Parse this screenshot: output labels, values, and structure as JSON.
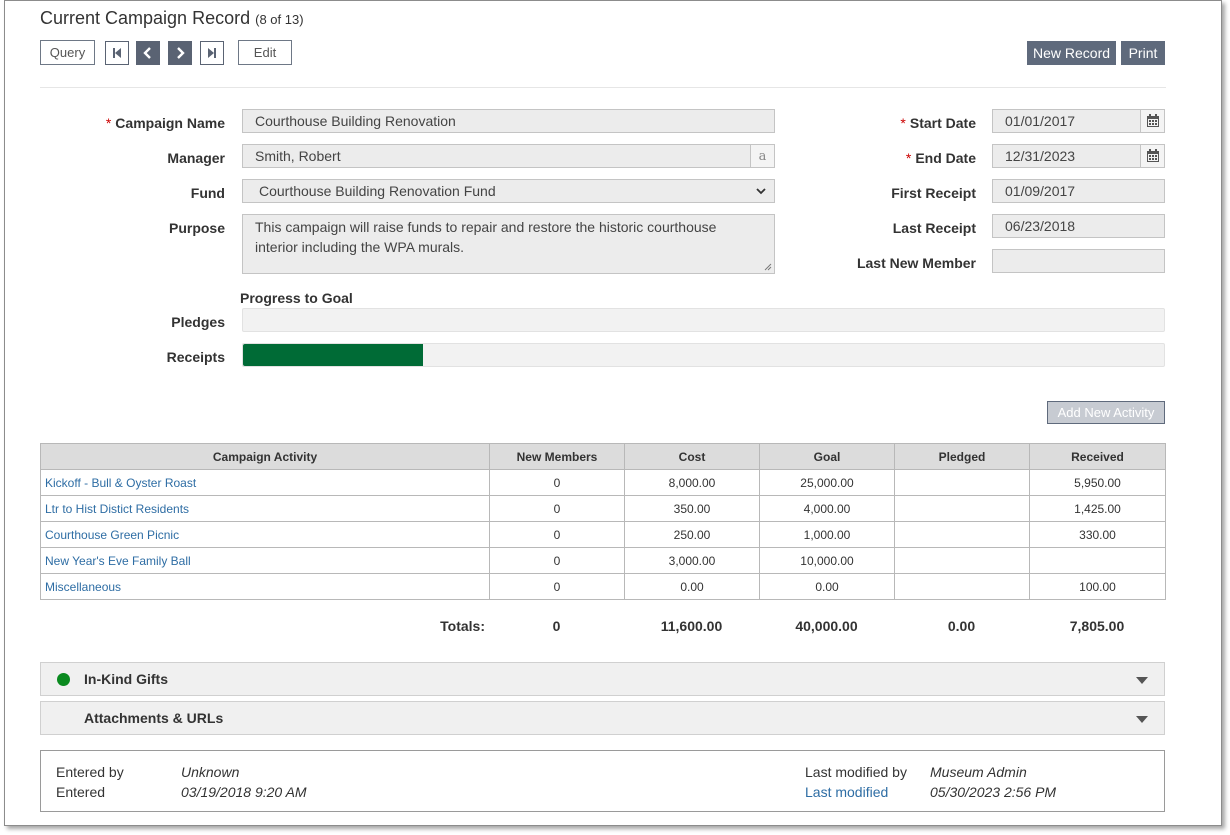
{
  "header": {
    "title": "Current Campaign Record",
    "record_position": "(8 of 13)"
  },
  "toolbar": {
    "query_label": "Query",
    "edit_label": "Edit",
    "new_record_label": "New Record",
    "print_label": "Print"
  },
  "form": {
    "campaign_name": {
      "label": "Campaign Name",
      "required": "*",
      "value": "Courthouse Building Renovation"
    },
    "manager": {
      "label": "Manager",
      "value": "Smith, Robert",
      "lookup_glyph": "a"
    },
    "fund": {
      "label": "Fund",
      "value": "Courthouse Building Renovation Fund"
    },
    "purpose": {
      "label": "Purpose",
      "value": "This campaign will raise funds to repair and restore the historic courthouse interior including the WPA murals."
    },
    "start_date": {
      "label": "Start Date",
      "required": "*",
      "value": "01/01/2017"
    },
    "end_date": {
      "label": "End Date",
      "required": "*",
      "value": "12/31/2023"
    },
    "first_receipt": {
      "label": "First Receipt",
      "value": "01/09/2017"
    },
    "last_receipt": {
      "label": "Last Receipt",
      "value": "06/23/2018"
    },
    "last_new_member": {
      "label": "Last New Member",
      "value": ""
    }
  },
  "progress": {
    "heading": "Progress to Goal",
    "pledges": {
      "label": "Pledges",
      "fraction": 0.0
    },
    "receipts": {
      "label": "Receipts",
      "fraction": 0.195
    }
  },
  "activities": {
    "add_label": "Add New Activity",
    "columns": [
      "Campaign Activity",
      "New Members",
      "Cost",
      "Goal",
      "Pledged",
      "Received"
    ],
    "rows": [
      [
        "Kickoff - Bull & Oyster Roast",
        "0",
        "8,000.00",
        "25,000.00",
        "",
        "5,950.00"
      ],
      [
        "Ltr to Hist Distict Residents",
        "0",
        "350.00",
        "4,000.00",
        "",
        "1,425.00"
      ],
      [
        "Courthouse Green Picnic",
        "0",
        "250.00",
        "1,000.00",
        "",
        "330.00"
      ],
      [
        "New Year's Eve Family Ball",
        "0",
        "3,000.00",
        "10,000.00",
        "",
        ""
      ],
      [
        "Miscellaneous",
        "0",
        "0.00",
        "0.00",
        "",
        "100.00"
      ]
    ],
    "totals": {
      "label": "Totals:",
      "new_members": "0",
      "cost": "11,600.00",
      "goal": "40,000.00",
      "pledged": "0.00",
      "received": "7,805.00"
    }
  },
  "sections": {
    "in_kind": "In-Kind Gifts",
    "attachments": "Attachments & URLs"
  },
  "audit": {
    "entered_by_label": "Entered by",
    "entered_by": "Unknown",
    "entered_label": "Entered",
    "entered": "03/19/2018 9:20 AM",
    "modified_by_label": "Last modified by",
    "modified_by": "Museum Admin",
    "modified_label": "Last modified",
    "modified": "05/30/2023 2:56 PM"
  },
  "colors": {
    "accent": "#5f6a7c",
    "progress_fill": "#006b36",
    "link": "#2e6da4",
    "required": "#cc0000",
    "status_dot": "#0a8a1f"
  }
}
